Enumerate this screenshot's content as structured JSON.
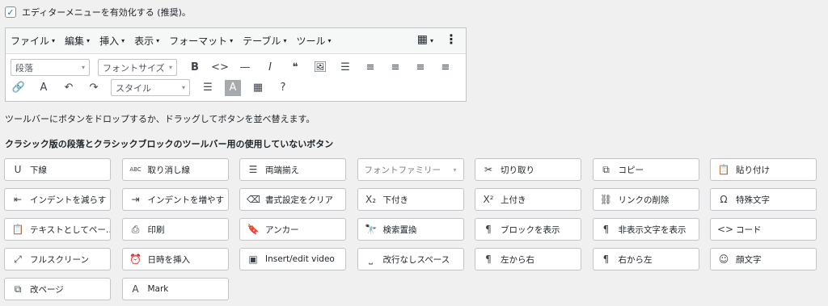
{
  "editor_menu_checkbox": {
    "checked_mark": "✓",
    "label": "エディターメニューを有効化する (推奨)。"
  },
  "editor": {
    "menus": [
      {
        "label": "ファイル",
        "name": "menu-file"
      },
      {
        "label": "編集",
        "name": "menu-edit"
      },
      {
        "label": "挿入",
        "name": "menu-insert"
      },
      {
        "label": "表示",
        "name": "menu-view"
      },
      {
        "label": "フォーマット",
        "name": "menu-format"
      },
      {
        "label": "テーブル",
        "name": "menu-table"
      },
      {
        "label": "ツール",
        "name": "menu-tools"
      }
    ],
    "caret": "▾",
    "table_icon": "▦",
    "kebab": "⋮",
    "paragraph_select": "段落",
    "font_size_select": "フォントサイズ",
    "style_select": "スタイル",
    "row1_icons": [
      {
        "glyph": "B",
        "name": "bold-icon"
      },
      {
        "glyph": "<>",
        "name": "code-icon"
      },
      {
        "glyph": "—",
        "name": "horizontal-line-icon"
      },
      {
        "glyph": "I",
        "name": "italic-icon"
      },
      {
        "glyph": "❝",
        "name": "blockquote-icon"
      },
      {
        "glyph": "🖼",
        "name": "image-icon"
      },
      {
        "glyph": "☰",
        "name": "bullet-list-icon"
      },
      {
        "glyph": "≡",
        "name": "numbered-list-icon"
      },
      {
        "glyph": "≡",
        "name": "align-left-icon"
      },
      {
        "glyph": "≡",
        "name": "align-center-icon"
      },
      {
        "glyph": "≡",
        "name": "align-right-icon"
      }
    ],
    "row2_left_icons": [
      {
        "glyph": "🔗",
        "name": "link-icon"
      },
      {
        "glyph": "A",
        "name": "text-color-icon"
      },
      {
        "glyph": "↶",
        "name": "undo-icon"
      },
      {
        "glyph": "↷",
        "name": "redo-icon"
      }
    ],
    "row2_right_icons": [
      {
        "glyph": "☰",
        "name": "toolbar-toggle-icon"
      },
      {
        "glyph": "A",
        "name": "background-color-icon"
      },
      {
        "glyph": "▦",
        "name": "table-icon"
      },
      {
        "glyph": "?",
        "name": "help-icon"
      }
    ]
  },
  "help_text": "ツールバーにボタンをドロップするか、ドラッグしてボタンを並べ替えます。",
  "unused_heading": "クラシック版の段落とクラシックブロックのツールバー用の使用していないボタン",
  "unused_buttons": [
    {
      "label": "下線",
      "icon": "U",
      "name": "underline-button",
      "icon_name": "underline-icon"
    },
    {
      "label": "取り消し線",
      "icon": "ABC",
      "name": "strikethrough-button",
      "icon_name": "strikethrough-icon"
    },
    {
      "label": "両端揃え",
      "icon": "☰",
      "name": "justify-button",
      "icon_name": "justify-icon"
    },
    {
      "label": "フォントファミリー",
      "icon": "",
      "name": "font-family-select",
      "icon_name": "chevron-down-icon",
      "is_select": true
    },
    {
      "label": "切り取り",
      "icon": "✂",
      "name": "cut-button",
      "icon_name": "scissors-icon"
    },
    {
      "label": "コピー",
      "icon": "⧉",
      "name": "copy-button",
      "icon_name": "copy-icon"
    },
    {
      "label": "貼り付け",
      "icon": "📋",
      "name": "paste-button",
      "icon_name": "clipboard-icon"
    },
    {
      "label": "インデントを減らす",
      "icon": "⇤",
      "name": "outdent-button",
      "icon_name": "outdent-icon"
    },
    {
      "label": "インデントを増やす",
      "icon": "⇥",
      "name": "indent-button",
      "icon_name": "indent-icon"
    },
    {
      "label": "書式設定をクリア",
      "icon": "⌫",
      "name": "clear-formatting-button",
      "icon_name": "eraser-icon"
    },
    {
      "label": "下付き",
      "icon": "X₂",
      "name": "subscript-button",
      "icon_name": "subscript-icon"
    },
    {
      "label": "上付き",
      "icon": "X²",
      "name": "superscript-button",
      "icon_name": "superscript-icon"
    },
    {
      "label": "リンクの削除",
      "icon": "⛓",
      "name": "unlink-button",
      "icon_name": "unlink-icon"
    },
    {
      "label": "特殊文字",
      "icon": "Ω",
      "name": "special-character-button",
      "icon_name": "omega-icon"
    },
    {
      "label": "テキストとしてペー…",
      "icon": "📋",
      "name": "paste-as-text-button",
      "icon_name": "paste-text-icon"
    },
    {
      "label": "印刷",
      "icon": "⎙",
      "name": "print-button",
      "icon_name": "printer-icon"
    },
    {
      "label": "アンカー",
      "icon": "🔖",
      "name": "anchor-button",
      "icon_name": "bookmark-icon"
    },
    {
      "label": "検索置換",
      "icon": "🔭",
      "name": "search-replace-button",
      "icon_name": "binoculars-icon"
    },
    {
      "label": "ブロックを表示",
      "icon": "¶",
      "name": "show-blocks-button",
      "icon_name": "pilcrow-icon"
    },
    {
      "label": "非表示文字を表示",
      "icon": "¶",
      "name": "show-invisibles-button",
      "icon_name": "pilcrow-invisible-icon"
    },
    {
      "label": "コード",
      "icon": "<>",
      "name": "code-button",
      "icon_name": "code-icon"
    },
    {
      "label": "フルスクリーン",
      "icon": "⤢",
      "name": "fullscreen-button",
      "icon_name": "fullscreen-icon"
    },
    {
      "label": "日時を挿入",
      "icon": "⏰",
      "name": "insert-datetime-button",
      "icon_name": "clock-icon"
    },
    {
      "label": "Insert/edit video",
      "icon": "▣",
      "name": "insert-video-button",
      "icon_name": "video-icon"
    },
    {
      "label": "改行なしスペース",
      "icon": "⎵",
      "name": "nonbreaking-space-button",
      "icon_name": "nbsp-icon"
    },
    {
      "label": "左から右",
      "icon": "¶",
      "name": "ltr-button",
      "icon_name": "ltr-icon"
    },
    {
      "label": "右から左",
      "icon": "¶",
      "name": "rtl-button",
      "icon_name": "rtl-icon"
    },
    {
      "label": "顔文字",
      "icon": "☺",
      "name": "emoticons-button",
      "icon_name": "smiley-icon"
    },
    {
      "label": "改ページ",
      "icon": "⧉",
      "name": "page-break-button",
      "icon_name": "page-break-icon"
    },
    {
      "label": "Mark",
      "icon": "A",
      "name": "mark-button",
      "icon_name": "highlight-icon"
    }
  ]
}
